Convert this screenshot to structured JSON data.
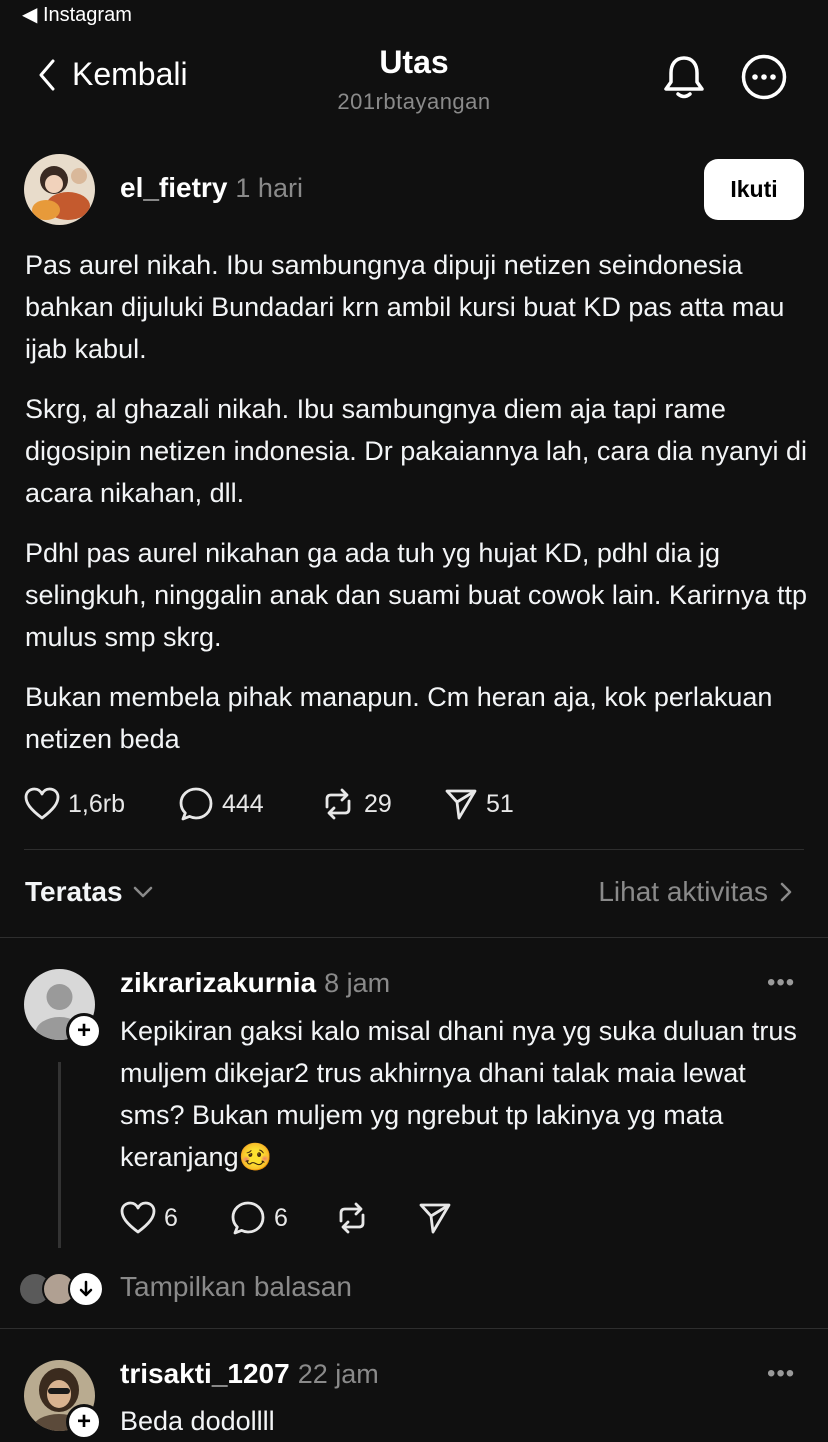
{
  "status_bar": {
    "back_app": "◀ Instagram"
  },
  "header": {
    "back_label": "Kembali",
    "title": "Utas",
    "subtitle": "201rbtayangan"
  },
  "post": {
    "username": "el_fietry",
    "time": "1 hari",
    "follow_label": "Ikuti",
    "paragraphs": [
      "Pas aurel nikah. Ibu sambungnya dipuji netizen seindonesia bahkan dijuluki Bundadari krn ambil kursi buat KD pas atta mau ijab kabul.",
      "Skrg, al ghazali nikah. Ibu sambungnya diem aja tapi rame digosipin netizen indonesia. Dr pakaiannya lah, cara dia nyanyi di acara nikahan, dll.",
      "Pdhl pas aurel nikahan ga ada tuh yg hujat KD, pdhl dia jg selingkuh, ninggalin anak dan suami buat cowok lain. Karirnya ttp mulus smp skrg.",
      "Bukan membela pihak manapun. Cm heran aja, kok perlakuan netizen beda"
    ],
    "likes": "1,6rb",
    "comments": "444",
    "reposts": "29",
    "shares": "51"
  },
  "sort_bar": {
    "sort_label": "Teratas",
    "activity_label": "Lihat aktivitas"
  },
  "replies": [
    {
      "username": "zikrarizakurnia",
      "time": "8 jam",
      "text": "Kepikiran gaksi kalo misal dhani nya yg suka duluan trus muljem dikejar2 trus akhirnya dhani talak maia lewat sms? Bukan muljem yg ngrebut tp lakinya yg mata keranjang",
      "emoji": "🥴",
      "likes": "6",
      "comments": "6",
      "show_replies_label": "Tampilkan balasan"
    },
    {
      "username": "trisakti_1207",
      "time": "22 jam",
      "text": "Beda dodollll"
    }
  ],
  "colors": {
    "background": "#101010",
    "text": "#f3f5f7",
    "muted": "#8a8a8a",
    "divider": "#2e2e2e",
    "button_bg": "#ffffff"
  }
}
